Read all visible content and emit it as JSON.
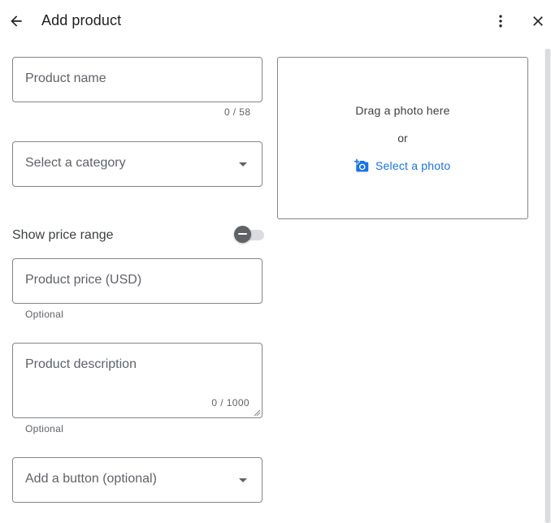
{
  "header": {
    "title": "Add product",
    "back_icon": "arrow-back-icon",
    "more_icon": "more-vert-icon",
    "close_icon": "close-icon"
  },
  "form": {
    "product_name": {
      "placeholder": "Product name",
      "value": "",
      "counter": "0 / 58"
    },
    "category": {
      "placeholder": "Select a category",
      "selected": ""
    },
    "price_range": {
      "label": "Show price range",
      "enabled": false
    },
    "product_price": {
      "placeholder": "Product price (USD)",
      "value": "",
      "helper": "Optional"
    },
    "product_description": {
      "placeholder": "Product description",
      "value": "",
      "counter": "0 / 1000",
      "helper": "Optional"
    },
    "button_select": {
      "placeholder": "Add a button (optional)",
      "selected": ""
    }
  },
  "photo": {
    "drag_text": "Drag a photo here",
    "or_text": "or",
    "select_label": "Select a photo",
    "select_icon": "add-photo-icon"
  },
  "colors": {
    "accent": "#1a73e8",
    "border": "#80868b",
    "text": "#3c4043",
    "secondary_text": "#5f6368"
  }
}
